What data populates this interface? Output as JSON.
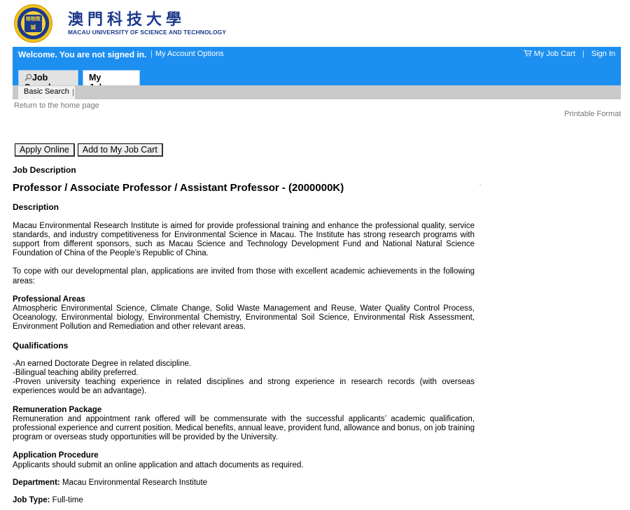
{
  "brand": {
    "name_cn": "澳門科技大學",
    "name_en": "MACAU UNIVERSITY OF SCIENCE AND TECHNOLOGY",
    "seal_text": "格物致誠"
  },
  "topbar": {
    "welcome": "Welcome. You are not signed in.",
    "account_options": "My Account Options",
    "job_cart": "My Job Cart",
    "sign_in": "Sign In"
  },
  "tabs": {
    "job_search": "Job Search",
    "my_jobpage": "My Jobpage"
  },
  "subtabs": {
    "basic_search": "Basic Search"
  },
  "links": {
    "home": "Return to the home page",
    "printable": "Printable Format"
  },
  "buttons": {
    "apply": "Apply Online",
    "add_cart": "Add to My Job Cart"
  },
  "job": {
    "section_label": "Job Description",
    "title": "Professor / Associate Professor / Assistant Professor - (2000000K)",
    "description_label": "Description",
    "description_p1": "Macau Environmental Research Institute is aimed for provide professional training and enhance the professional quality, service standards, and industry competitiveness for Environmental Science in Macau. The Institute has strong research programs with support from different sponsors, such as Macau Science and Technology Development Fund and National Natural Science Foundation of China of the People’s Republic of China.",
    "description_p2": "To cope with our developmental plan, applications are invited from those with excellent academic achievements in the following areas:",
    "areas_label": "Professional Areas",
    "areas_text": "Atmospheric Environmental Science, Climate Change, Solid Waste Management and Reuse, Water Quality Control Process, Oceanology, Environmental biology, Environmental Chemistry, Environmental Soil Science, Environmental Risk Assessment, Environment Pollution and Remediation and other relevant areas.",
    "qualifications_label": "Qualifications",
    "qualifications": [
      "-An earned Doctorate Degree in related discipline.",
      "-Bilingual teaching ability preferred.",
      "-Proven university teaching experience in related disciplines and strong experience in research records (with overseas experiences would be an advantage)."
    ],
    "remuneration_label": "Remuneration Package",
    "remuneration_text": "Remuneration and appointment rank offered will be commensurate with the successful applicants’ academic qualification, professional experience and current position. Medical benefits, annual leave, provident fund, allowance and bonus, on job training program or overseas study opportunities will be provided by the University.",
    "procedure_label": "Application Procedure",
    "procedure_text": "Applicants should submit an online application and attach documents as required.",
    "department_label": "Department:",
    "department_value": "Macau Environmental Research Institute",
    "jobtype_label": "Job Type:",
    "jobtype_value": "Full-time"
  }
}
